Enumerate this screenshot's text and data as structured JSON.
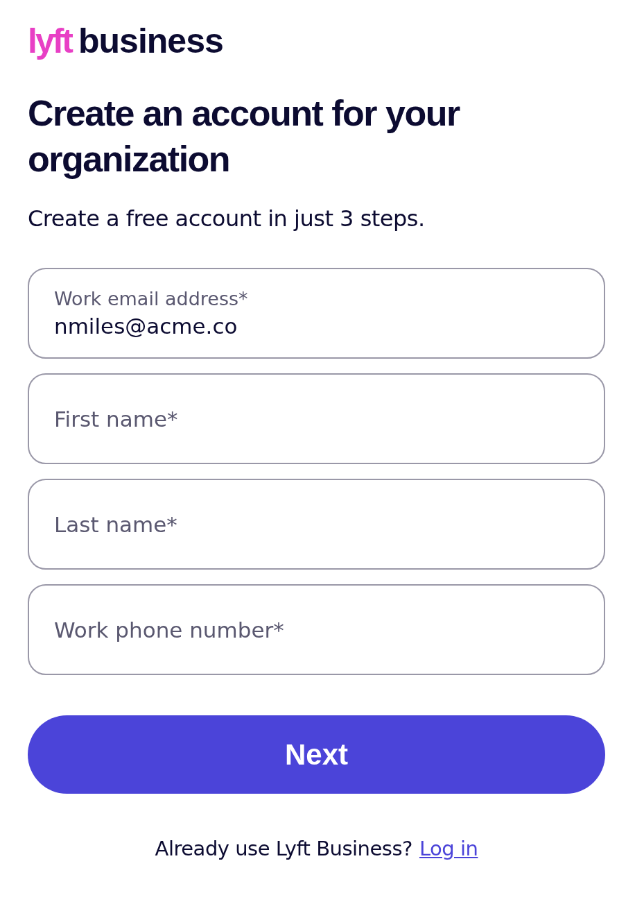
{
  "logo": {
    "brand": "lyft",
    "product": "business"
  },
  "title": "Create an account for your organization",
  "subtitle": "Create a free account in just 3 steps.",
  "fields": [
    {
      "label": "Work email address*",
      "value": "nmiles@acme.co"
    },
    {
      "placeholder": "First name*"
    },
    {
      "placeholder": "Last name*"
    },
    {
      "placeholder": "Work phone number*"
    }
  ],
  "button": "Next",
  "footer": {
    "text": "Already use Lyft Business?",
    "link": "Log in"
  }
}
